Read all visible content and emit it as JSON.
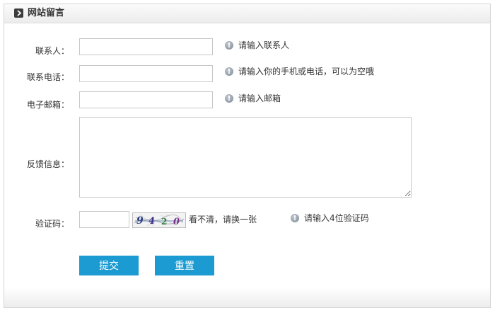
{
  "header": {
    "title": "网站留言",
    "icon": "chevron-right-icon"
  },
  "form": {
    "contact": {
      "label": "联系人：",
      "value": "",
      "hint": "请输入联系人"
    },
    "phone": {
      "label": "联系电话：",
      "value": "",
      "hint": "请输入你的手机或电话，可以为空哦"
    },
    "email": {
      "label": "电子邮箱：",
      "value": "",
      "hint": "请输入邮箱"
    },
    "feedback": {
      "label": "反馈信息：",
      "value": ""
    },
    "captcha": {
      "label": "验证码：",
      "value": "",
      "code": [
        "9",
        "4",
        "2",
        "0"
      ],
      "refresh_text": "看不清，请换一张",
      "hint": "请输入4位验证码"
    }
  },
  "buttons": {
    "submit": "提交",
    "reset": "重置"
  },
  "colors": {
    "button_bg": "#1b9bd2",
    "hint_icon": "#8a95a1"
  }
}
